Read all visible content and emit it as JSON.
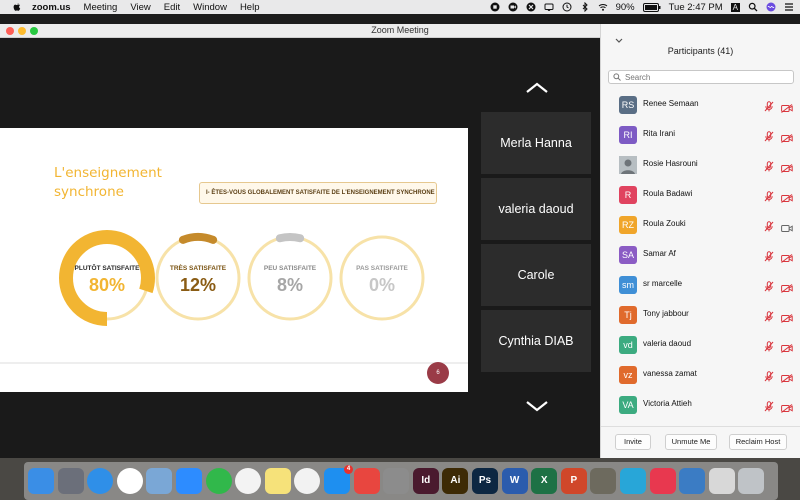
{
  "menubar": {
    "app_name": "zoom.us",
    "menus": [
      "Meeting",
      "View",
      "Edit",
      "Window",
      "Help"
    ],
    "battery": "90%",
    "clock": "Tue 2:47 PM",
    "input_source": "A"
  },
  "window": {
    "title": "Zoom Meeting"
  },
  "slide": {
    "title": "L'enseignement synchrone",
    "question": "I- ÊTES-VOUS GLOBALEMENT SATISFAITE DE L'ENSEIGNEMENT SYNCHRONE SUR ZOOM?",
    "page_number": "6",
    "colors": {
      "gold": "#f2b532",
      "dark_gold": "#c58a2b",
      "gray": "#c4c4c4",
      "ring": "#f7e2a8"
    }
  },
  "chart_data": {
    "type": "pie",
    "categories": [
      "PLUTÔT SATISFAITE",
      "TRÈS SATISFAITE",
      "PEU SATISFAITE",
      "PAS SATISFAITE"
    ],
    "values": [
      80,
      12,
      8,
      0
    ],
    "value_labels": [
      "80%",
      "12%",
      "8%",
      "0%"
    ],
    "title": "",
    "legend": "none"
  },
  "video_tiles": [
    {
      "name": "Merla Hanna"
    },
    {
      "name": "valeria daoud"
    },
    {
      "name": "Carole"
    },
    {
      "name": "Cynthia DIAB"
    }
  ],
  "participants_panel": {
    "title": "Participants (41)",
    "search_placeholder": "Search",
    "participants": [
      {
        "initials": "RS",
        "name": "Renee Semaan",
        "color": "#5a6e85",
        "camera": "off"
      },
      {
        "initials": "RI",
        "name": "Rita Irani",
        "color": "#7d5bc4",
        "camera": "off"
      },
      {
        "initials": "",
        "name": "Rosie Hasrouni",
        "color": "#9aa3a8",
        "camera": "off"
      },
      {
        "initials": "R",
        "name": "Roula Badawi",
        "color": "#e0435f",
        "camera": "off"
      },
      {
        "initials": "RZ",
        "name": "Roula Zouki",
        "color": "#f0a52a",
        "camera": "on"
      },
      {
        "initials": "SA",
        "name": "Samar Af",
        "color": "#8b5cc4",
        "camera": "off"
      },
      {
        "initials": "sm",
        "name": "sr marcelle",
        "color": "#3f8fd6",
        "camera": "off"
      },
      {
        "initials": "Tj",
        "name": "Tony jabbour",
        "color": "#e06a2c",
        "camera": "off"
      },
      {
        "initials": "vd",
        "name": "valeria daoud",
        "color": "#3cab80",
        "camera": "off"
      },
      {
        "initials": "vz",
        "name": "vanessa zamat",
        "color": "#e06a2c",
        "camera": "off"
      },
      {
        "initials": "VA",
        "name": "Victoria Attieh",
        "color": "#3cab80",
        "camera": "off"
      }
    ],
    "buttons": {
      "invite": "Invite",
      "unmute_me": "Unmute Me",
      "reclaim_host": "Reclaim Host"
    }
  },
  "dock": {
    "apps": [
      {
        "name": "Finder",
        "label": "",
        "color": "#3a8ee6"
      },
      {
        "name": "Launchpad",
        "label": "",
        "color": "#6b6f7a"
      },
      {
        "name": "Safari",
        "label": "",
        "color": "#2f8fe8"
      },
      {
        "name": "Chrome",
        "label": "",
        "color": "#ffffff"
      },
      {
        "name": "Preview",
        "label": "",
        "color": "#7aa7d6"
      },
      {
        "name": "Zoom",
        "label": "",
        "color": "#2d8cff"
      },
      {
        "name": "FaceTime",
        "label": "",
        "color": "#31b84b"
      },
      {
        "name": "Photos",
        "label": "",
        "color": "#f3f3f3"
      },
      {
        "name": "Notes",
        "label": "",
        "color": "#f6e27a"
      },
      {
        "name": "iTunes",
        "label": "",
        "color": "#f2f2f2"
      },
      {
        "name": "App Store",
        "label": "",
        "color": "#1e8ff0",
        "badge": "4"
      },
      {
        "name": "AnyDesk",
        "label": "",
        "color": "#e8463f"
      },
      {
        "name": "System Preferences",
        "label": "",
        "color": "#8c8c8c"
      },
      {
        "name": "InDesign",
        "label": "Id",
        "color": "#4a1a2e"
      },
      {
        "name": "Illustrator",
        "label": "Ai",
        "color": "#3d2a05"
      },
      {
        "name": "Photoshop",
        "label": "Ps",
        "color": "#0d2742"
      },
      {
        "name": "Word",
        "label": "W",
        "color": "#2b5cad"
      },
      {
        "name": "Excel",
        "label": "X",
        "color": "#1e7145"
      },
      {
        "name": "PowerPoint",
        "label": "P",
        "color": "#d0472a"
      },
      {
        "name": "Game",
        "label": "",
        "color": "#6d6a5e"
      },
      {
        "name": "Accessibility",
        "label": "",
        "color": "#28a6d8"
      },
      {
        "name": "Creative Cloud",
        "label": "",
        "color": "#e8384f"
      },
      {
        "name": "Disk Utility",
        "label": "",
        "color": "#3b7cc4"
      },
      {
        "name": "Keyboard",
        "label": "",
        "color": "#d8d8d8"
      },
      {
        "name": "Trash",
        "label": "",
        "color": "#bfc3c7"
      }
    ]
  }
}
